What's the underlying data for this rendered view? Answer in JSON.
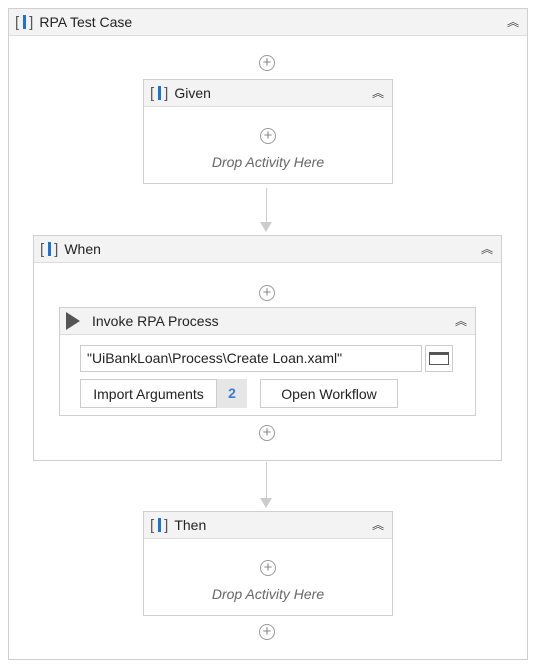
{
  "root": {
    "title": "RPA Test Case",
    "icon": "sequence-icon"
  },
  "given": {
    "title": "Given",
    "drop": "Drop Activity Here"
  },
  "when": {
    "title": "When"
  },
  "invoke": {
    "title": "Invoke RPA Process",
    "path": "\"UiBankLoan\\Process\\Create Loan.xaml\"",
    "import_label": "Import Arguments",
    "import_count": "2",
    "open_label": "Open Workflow"
  },
  "then": {
    "title": "Then",
    "drop": "Drop Activity Here"
  },
  "colors": {
    "accent": "#1a73d9",
    "badge": "#3a7bd5"
  }
}
